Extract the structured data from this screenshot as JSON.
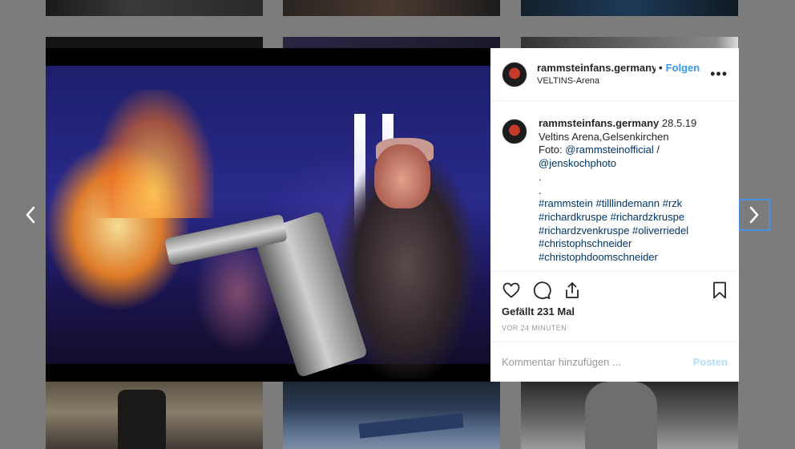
{
  "navigation": {
    "prev_icon": "chevron-left-icon",
    "next_icon": "chevron-right-icon"
  },
  "post": {
    "username": "rammsteinfans.germany",
    "separator": "•",
    "follow_label": "Folgen",
    "location": "VELTINS-Arena",
    "more_icon": "more-options-icon",
    "caption": {
      "username": "rammsteinfans.germany",
      "line1": " 28.5.19",
      "line2": "Veltins Arena,Gelsenkirchen",
      "line3_prefix": "Foto: ",
      "mention1": "@rammsteinofficial",
      "line3_suffix": " /",
      "mention2": "@jenskochphoto",
      "dot1": ".",
      "dot2": ".",
      "tags": [
        "#rammstein #tilllindemann #rzk",
        "#richardkruspe #richardzkruspe",
        "#richardzvenkruspe #oliverriedel",
        "#christophschneider",
        "#christophdoomschneider"
      ]
    },
    "likes": "Gefällt 231 Mal",
    "time": "VOR 24 MINUTEN",
    "comment_placeholder": "Kommentar hinzufügen ...",
    "post_button": "Posten"
  },
  "colors": {
    "link": "#3897f0",
    "hashtag": "#003569",
    "post_disabled": "#b2dffc"
  }
}
